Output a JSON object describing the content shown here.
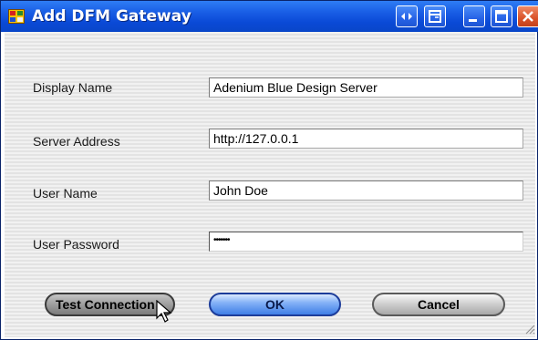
{
  "window": {
    "title": "Add DFM Gateway",
    "icon": "app-window-icon",
    "controls": [
      "expand-icon",
      "restore-icon",
      "minimize-icon",
      "maximize-icon",
      "close-icon"
    ]
  },
  "form": {
    "display_name": {
      "label": "Display Name",
      "value": "Adenium Blue Design Server"
    },
    "server_address": {
      "label": "Server Address",
      "value": "http://127.0.0.1"
    },
    "user_name": {
      "label": "User Name",
      "value": "John Doe"
    },
    "user_password": {
      "label": "User Password",
      "value": "•••••••"
    }
  },
  "buttons": {
    "test_connection": "Test Connection",
    "ok": "OK",
    "cancel": "Cancel"
  },
  "colors": {
    "titlebar": "#0a49d6",
    "close_button": "#d9532b",
    "ok_button": "#3f7ee6"
  }
}
